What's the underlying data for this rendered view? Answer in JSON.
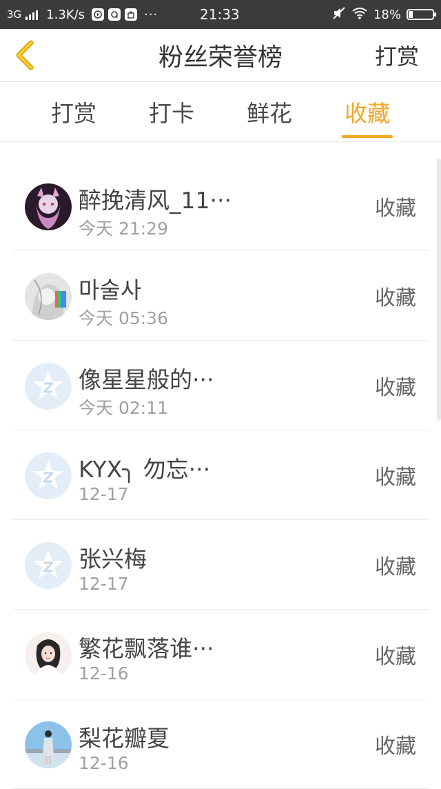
{
  "status_bar": {
    "network": "3G",
    "speed": "1.3K/s",
    "dots": "···",
    "time": "21:33",
    "battery": "18%",
    "battery_level": 0.18
  },
  "header": {
    "title": "粉丝荣誉榜",
    "action": "打赏"
  },
  "tabs": [
    {
      "label": "打赏"
    },
    {
      "label": "打卡"
    },
    {
      "label": "鲜花"
    },
    {
      "label": "收藏"
    }
  ],
  "active_tab": 3,
  "colors": {
    "accent": "#f5a623",
    "status_bar": "#3b3b3b",
    "text": "#444444",
    "secondary_text": "#a0a0a0"
  },
  "list": [
    {
      "name": "醉挽清风_11···",
      "time": "今天 21:29",
      "action": "收藏",
      "avatar": "anime-girl-dark"
    },
    {
      "name": "마술사",
      "time": "今天 05:36",
      "action": "收藏",
      "avatar": "anime-sketch-rainbow"
    },
    {
      "name": "像星星般的···",
      "time": "今天 02:11",
      "action": "收藏",
      "avatar": "default-star"
    },
    {
      "name": "KYX╮ 勿忘···",
      "time": "12-17",
      "action": "收藏",
      "avatar": "default-star"
    },
    {
      "name": "张兴梅",
      "time": "12-17",
      "action": "收藏",
      "avatar": "default-star"
    },
    {
      "name": "繁花飘落谁···",
      "time": "12-16",
      "action": "收藏",
      "avatar": "photo-girl"
    },
    {
      "name": "梨花瓣夏",
      "time": "12-16",
      "action": "收藏",
      "avatar": "photo-sky"
    }
  ]
}
